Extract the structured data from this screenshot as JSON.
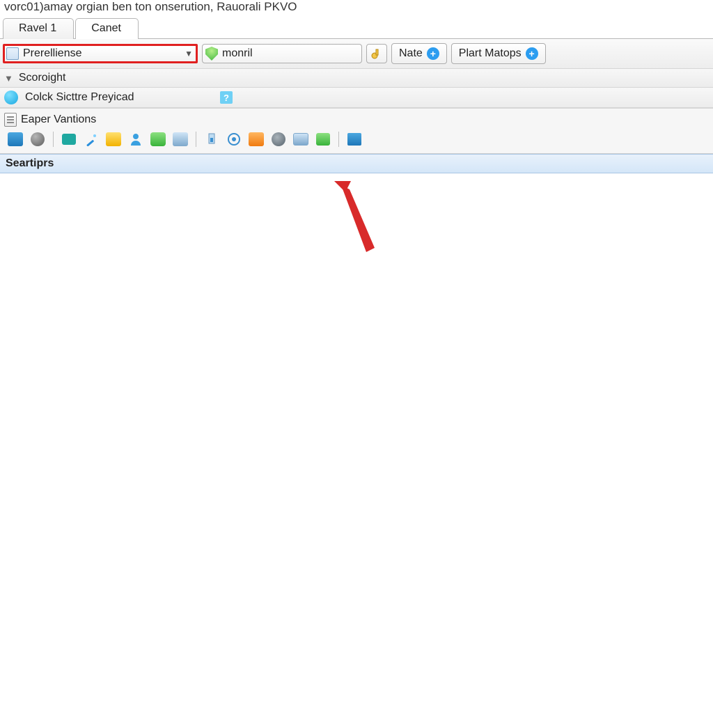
{
  "title": "vorc01)amay orgian ben ton onserution, Rauorali PKVO",
  "tabs": [
    {
      "label": "Ravel 1",
      "active": false
    },
    {
      "label": "Canet",
      "active": true
    }
  ],
  "toolbar1": {
    "dropdown_primary": {
      "value": "Prerelliense"
    },
    "dropdown_secondary": {
      "value": "monril"
    },
    "nate_button": "Nate",
    "plart_button": "Plart Matops"
  },
  "scoright_row": {
    "label": "Scoroight"
  },
  "click_row": {
    "label": "Colck Sicttre Preyicad",
    "help": "?"
  },
  "section": {
    "title": "Eaper Vantions"
  },
  "icon_row": [
    "list-blue-icon",
    "globe-gray-icon",
    "sep",
    "lines-teal-icon",
    "wand-blue-icon",
    "page-yellow-icon",
    "person-blue-icon",
    "chat-green-icon",
    "window-grayblue-icon",
    "sep",
    "gauge-blue-icon",
    "target-blue-icon",
    "folder-orange-icon",
    "sphere-steel-icon",
    "monitor-grayblue-icon",
    "chart-green-icon",
    "sep",
    "disk-blue-icon"
  ],
  "column_header": "Seartiprs",
  "annotation": {
    "arrow": "pointer-arrow"
  }
}
